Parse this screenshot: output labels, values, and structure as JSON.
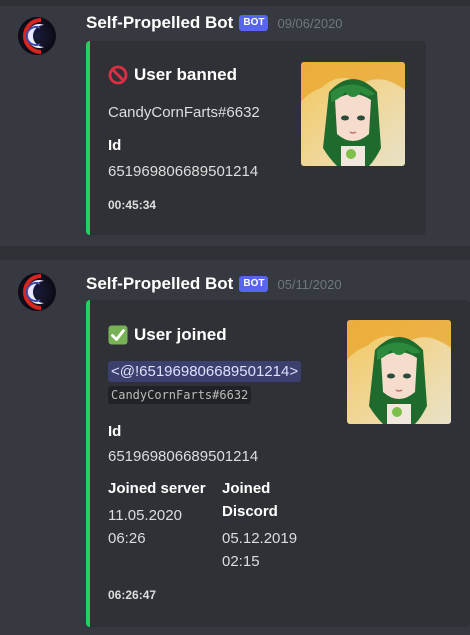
{
  "colors": {
    "embed_border": "#23d160",
    "bot_tag": "#5865f2",
    "mention_bg": "#3e4385",
    "background": "#36393f",
    "embed_bg": "#2f3136"
  },
  "messages": [
    {
      "username": "Self-Propelled Bot",
      "bot_tag": "BOT",
      "timestamp": "09/06/2020",
      "avatar_icon": "crescent-moon-avatar",
      "embed": {
        "title_icon": "prohibited-icon",
        "title": "User banned",
        "user_tag": "CandyCornFarts#6632",
        "fields": [
          {
            "name": "Id",
            "value": "651969806689501214"
          }
        ],
        "footer": "00:45:34",
        "thumbnail": "green-haired-anime-girl"
      }
    },
    {
      "username": "Self-Propelled Bot",
      "bot_tag": "BOT",
      "timestamp": "05/11/2020",
      "avatar_icon": "crescent-moon-avatar",
      "embed": {
        "title_icon": "check-mark-icon",
        "title": "User joined",
        "mention": "<@!651969806689501214>",
        "user_tag_code": "CandyCornFarts#6632",
        "fields": [
          {
            "name": "Id",
            "value": "651969806689501214"
          },
          {
            "name": "Joined server",
            "value_line1": "11.05.2020",
            "value_line2": "06:26"
          },
          {
            "name_line1": "Joined",
            "name_line2": "Discord",
            "value_line1": "05.12.2019",
            "value_line2": "02:15"
          }
        ],
        "footer": "06:26:47",
        "thumbnail": "green-haired-anime-girl"
      }
    }
  ]
}
